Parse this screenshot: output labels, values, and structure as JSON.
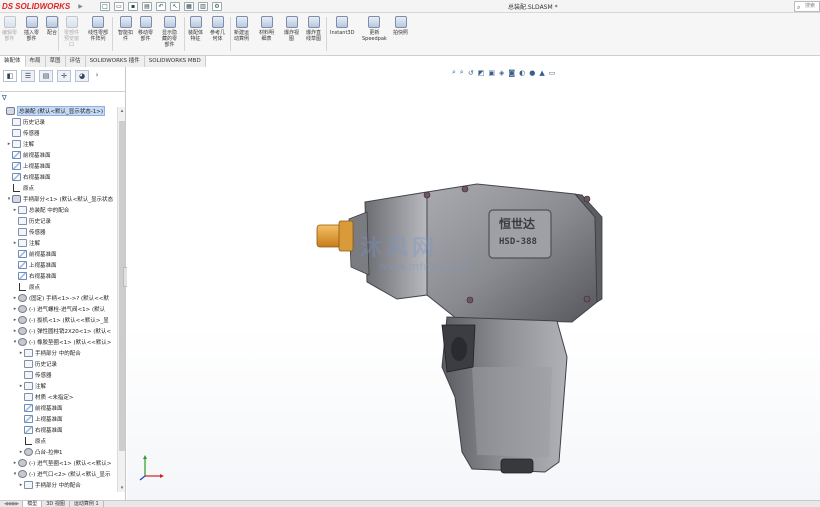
{
  "app": {
    "logo_ds": "DS",
    "logo_name": "SOLIDWORKS",
    "document_title": "总装配.SLDASM *",
    "search_placeholder": "搜索"
  },
  "ribbon": {
    "buttons": [
      {
        "label": "编辑零\n部件",
        "enabled": false
      },
      {
        "label": "插入零\n部件",
        "enabled": true
      },
      {
        "label": "配合",
        "enabled": true
      },
      {
        "label": "零部件\n预览窗\n口",
        "enabled": false
      },
      {
        "label": "线性零部\n件阵列",
        "enabled": true
      },
      {
        "label": "智能扣\n件",
        "enabled": true
      },
      {
        "label": "移动零\n部件",
        "enabled": true
      },
      {
        "label": "显示隐\n藏的零\n部件",
        "enabled": true
      },
      {
        "label": "装配体\n特征",
        "enabled": true
      },
      {
        "label": "参考几\n何体",
        "enabled": true
      },
      {
        "label": "新建运\n动算例",
        "enabled": true
      },
      {
        "label": "材料明\n细表",
        "enabled": true
      },
      {
        "label": "爆炸视\n图",
        "enabled": true
      },
      {
        "label": "爆炸直\n线草图",
        "enabled": true
      },
      {
        "label": "Instant3D",
        "enabled": true
      },
      {
        "label": "更新\nSpeedpak",
        "enabled": true
      },
      {
        "label": "拍快照",
        "enabled": true
      }
    ]
  },
  "command_tabs": [
    "装配体",
    "布局",
    "草图",
    "评估",
    "SOLIDWORKS 插件",
    "SOLIDWORKS MBD"
  ],
  "tree": [
    {
      "text": "总装配 (默认<默认_显示状态-1>)",
      "level": 0,
      "icon": "asm",
      "toggle": "",
      "selected": true
    },
    {
      "text": "历史记录",
      "level": 1,
      "icon": "box",
      "toggle": ""
    },
    {
      "text": "传感器",
      "level": 1,
      "icon": "box",
      "toggle": ""
    },
    {
      "text": "注解",
      "level": 1,
      "icon": "box",
      "toggle": "▸"
    },
    {
      "text": "前视基准面",
      "level": 1,
      "icon": "plane",
      "toggle": ""
    },
    {
      "text": "上视基准面",
      "level": 1,
      "icon": "plane",
      "toggle": ""
    },
    {
      "text": "右视基准面",
      "level": 1,
      "icon": "plane",
      "toggle": ""
    },
    {
      "text": "原点",
      "level": 1,
      "icon": "origin",
      "toggle": ""
    },
    {
      "text": "手柄部分<1> (默认<默认_显示状态",
      "level": 1,
      "icon": "asm",
      "toggle": "▾"
    },
    {
      "text": "总装配 中的配合",
      "level": 2,
      "icon": "box",
      "toggle": "▸"
    },
    {
      "text": "历史记录",
      "level": 2,
      "icon": "box",
      "toggle": ""
    },
    {
      "text": "传感器",
      "level": 2,
      "icon": "box",
      "toggle": ""
    },
    {
      "text": "注解",
      "level": 2,
      "icon": "box",
      "toggle": "▸"
    },
    {
      "text": "前视基准面",
      "level": 2,
      "icon": "plane",
      "toggle": ""
    },
    {
      "text": "上视基准面",
      "level": 2,
      "icon": "plane",
      "toggle": ""
    },
    {
      "text": "右视基准面",
      "level": 2,
      "icon": "plane",
      "toggle": ""
    },
    {
      "text": "原点",
      "level": 2,
      "icon": "origin",
      "toggle": ""
    },
    {
      "text": "(固定) 手柄<1>->? (默认<<默",
      "level": 2,
      "icon": "part",
      "toggle": "▸"
    },
    {
      "text": "(-) 进气螺栓-进气阀<1> (默认",
      "level": 2,
      "icon": "part",
      "toggle": "▸"
    },
    {
      "text": "(-) 扳机<1> (默认<<默认>_显",
      "level": 2,
      "icon": "part",
      "toggle": "▸"
    },
    {
      "text": "(-) 弹性圆柱销2X20<1> (默认<",
      "level": 2,
      "icon": "part",
      "toggle": "▸"
    },
    {
      "text": "(-) 橡胶垫圈<1> (默认<<默认>",
      "level": 2,
      "icon": "part",
      "toggle": "▾"
    },
    {
      "text": "手柄部分 中的配合",
      "level": 3,
      "icon": "box",
      "toggle": "▸"
    },
    {
      "text": "历史记录",
      "level": 3,
      "icon": "box",
      "toggle": ""
    },
    {
      "text": "传感器",
      "level": 3,
      "icon": "box",
      "toggle": ""
    },
    {
      "text": "注解",
      "level": 3,
      "icon": "box",
      "toggle": "▸"
    },
    {
      "text": "材质 <未指定>",
      "level": 3,
      "icon": "box",
      "toggle": ""
    },
    {
      "text": "前视基准面",
      "level": 3,
      "icon": "plane",
      "toggle": ""
    },
    {
      "text": "上视基准面",
      "level": 3,
      "icon": "plane",
      "toggle": ""
    },
    {
      "text": "右视基准面",
      "level": 3,
      "icon": "plane",
      "toggle": ""
    },
    {
      "text": "原点",
      "level": 3,
      "icon": "origin",
      "toggle": ""
    },
    {
      "text": "凸台-拉伸1",
      "level": 3,
      "icon": "part",
      "toggle": "▸"
    },
    {
      "text": "(-) 进气垫圈<1> (默认<<默认>",
      "level": 2,
      "icon": "part",
      "toggle": "▸"
    },
    {
      "text": "(-) 进气口<2> (默认<默认_显示",
      "level": 2,
      "icon": "part",
      "toggle": "▾"
    },
    {
      "text": "手柄部分 中的配合",
      "level": 3,
      "icon": "box",
      "toggle": "▸"
    }
  ],
  "bottom_tabs": [
    "模型",
    "3D 视图",
    "运动算例 1"
  ],
  "model": {
    "brand_text": "恒世达",
    "model_text": "HSD-388"
  },
  "watermark": {
    "line1": "沐风网",
    "line2": "www.mfcad.com"
  },
  "colors": {
    "selection": "#c7d9f3",
    "brand_red": "#e0261e",
    "body_gray": "#8e9096",
    "anvil_orange": "#e5a33c"
  }
}
